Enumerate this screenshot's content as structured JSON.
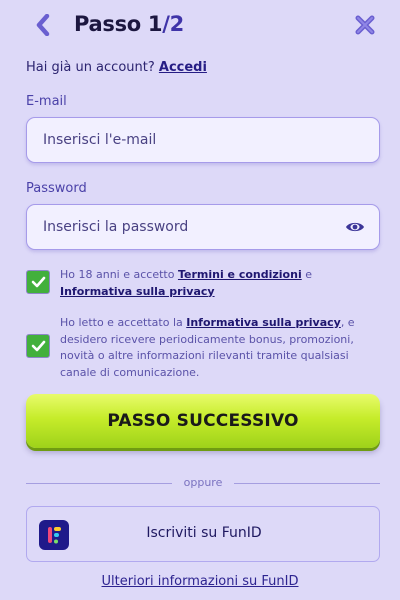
{
  "header": {
    "title_prefix": "Passo 1",
    "title_total": "/2",
    "back_icon": "chevron-left-icon",
    "close_icon": "close-icon"
  },
  "login": {
    "question": "Hai già un account? ",
    "link": "Accedi"
  },
  "email": {
    "label": "E-mail",
    "placeholder": "Inserisci l'e-mail",
    "value": ""
  },
  "password": {
    "label": "Password",
    "placeholder": "Inserisci la password",
    "value": "",
    "toggle_icon": "eye-icon"
  },
  "consent1": {
    "checked": true,
    "text_a": "Ho 18 anni e accetto ",
    "link_a": "Termini e condizioni",
    "text_b": " e ",
    "link_b": "Informativa sulla privacy"
  },
  "consent2": {
    "checked": true,
    "text_a": "Ho letto e accettato la ",
    "link_a": "Informativa sulla privacy",
    "text_b": ", e desidero ricevere periodicamente bonus, promozioni, novità o altre informazioni rilevanti tramite qualsiasi canale di comunicazione."
  },
  "next_button": {
    "label": "PASSO SUCCESSIVO"
  },
  "divider": {
    "label": "oppure"
  },
  "funid": {
    "label": "Iscriviti su FunID",
    "more_info": "Ulteriori informazioni su FunID",
    "logo_icon": "funid-logo-icon"
  },
  "colors": {
    "background": "#ddd9f8",
    "accent": "#3f34a8",
    "checkbox": "#42b03c",
    "cta": "#c6ec2a"
  }
}
